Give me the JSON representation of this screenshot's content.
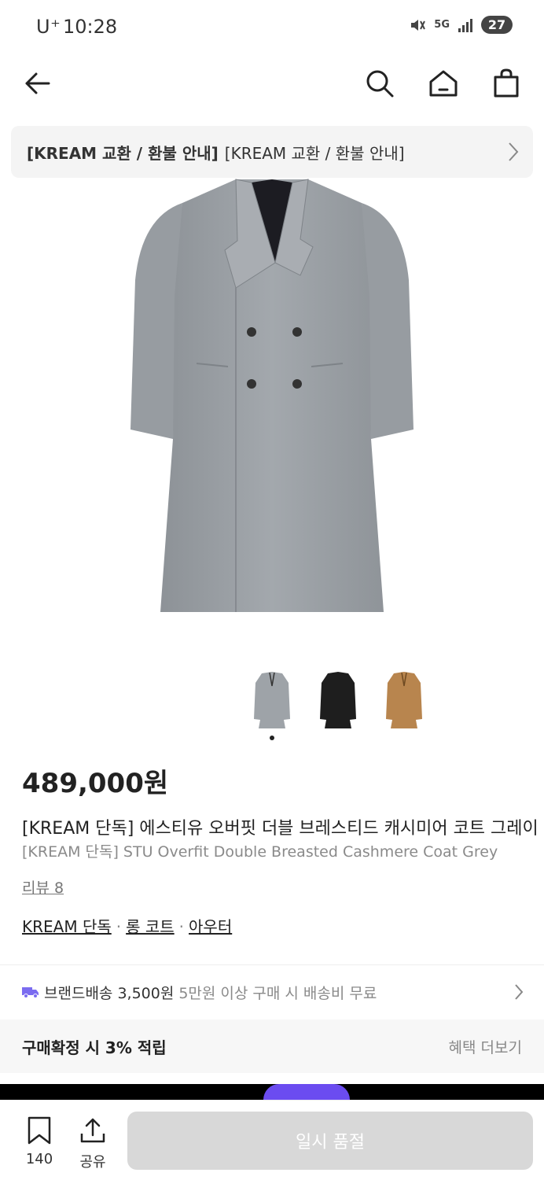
{
  "status_bar": {
    "carrier": "U⁺",
    "time": "10:28",
    "network": "5G",
    "battery": "27"
  },
  "nav": {
    "back": "back-arrow-icon",
    "search": "search-icon",
    "home": "home-icon",
    "cart": "shopping-bag-icon"
  },
  "notice": {
    "bold": "[KREAM 교환 / 환불 안내]",
    "text": "[KREAM 교환 / 환불 안내]"
  },
  "product": {
    "price": "489,000원",
    "title_ko": "[KREAM 단독] 에스티유 오버핏 더블 브레스티드 캐시미어 코트 그레이",
    "title_en": "[KREAM 단독] STU Overfit Double Breasted Cashmere Coat Grey",
    "review": "리뷰 8",
    "categories": [
      "KREAM 단독",
      "롱 코트",
      "아우터"
    ],
    "category_separator": "·",
    "thumbnails": [
      {
        "color": "#9ea3a8"
      },
      {
        "color": "#1e1e1e"
      },
      {
        "color": "#b8854e"
      }
    ]
  },
  "shipping": {
    "main": "브랜드배송 3,500원",
    "sub": "5만원 이상 구매 시 배송비 무료"
  },
  "benefit": {
    "text": "구매확정 시 3% 적립",
    "more": "혜택 더보기"
  },
  "bottom": {
    "bookmark_count": "140",
    "share_label": "공유",
    "soldout_label": "일시 품절"
  },
  "colors": {
    "coat_grey": "#9ca1a6",
    "accent": "#6b4cf0",
    "truck": "#7b6cf0"
  }
}
